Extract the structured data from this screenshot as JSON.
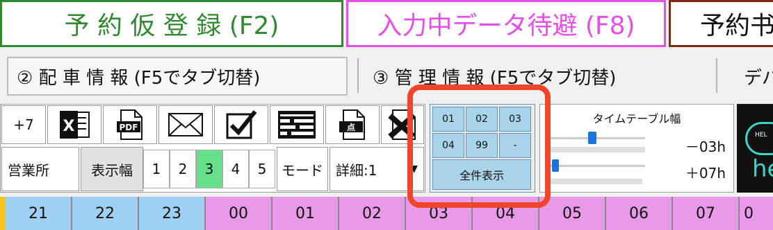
{
  "function_buttons": {
    "provisional_reservation": "予 約 仮 登 録 (F2)",
    "data_standby": "入力中データ待避 (F8)",
    "reservation_cut": "予約书"
  },
  "tabs": {
    "dispatch_info": "② 配 車 情 報 (F5でタブ切替)",
    "management_info": "③ 管 理 情 報 (F5でタブ切替)",
    "more": "デバ"
  },
  "toolbar": {
    "plus_days": "+7",
    "office_label": "営業所",
    "display_width_label": "表示幅",
    "width_options": [
      "1",
      "2",
      "3",
      "4",
      "5"
    ],
    "width_selected": "3",
    "mode_label": "モード",
    "mode_value": "詳細:1"
  },
  "group_filter": {
    "cells": [
      "01",
      "02",
      "03",
      "04",
      "99",
      "-"
    ],
    "show_all": "全件表示"
  },
  "timetable": {
    "title": "タイムテーブル幅",
    "before": "－03h",
    "after": "＋07h"
  },
  "brand_partial": "he",
  "brand_small": "HEL",
  "hours": [
    "21",
    "22",
    "23",
    "00",
    "01",
    "02",
    "03",
    "04",
    "05",
    "06",
    "07",
    "0"
  ],
  "colors": {
    "highlight": "#f0452a",
    "past_hour": "#9fcff2",
    "future_hour": "#e89ae8",
    "active_width": "#66e08a"
  }
}
